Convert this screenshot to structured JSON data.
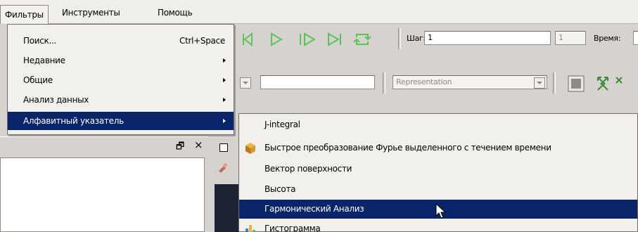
{
  "menubar": {
    "items": [
      "Фильтры",
      "Инструменты",
      "Помощь"
    ]
  },
  "toolbar": {
    "step_label": "Шаг:",
    "step_value": "1",
    "time_index_value": "1",
    "time_label": "Время:",
    "representation_placeholder": "Representation"
  },
  "filters_menu": {
    "items": [
      {
        "label": "Поиск...",
        "shortcut": "Ctrl+Space",
        "has_submenu": false
      },
      {
        "label": "Недавние",
        "shortcut": "",
        "has_submenu": true
      },
      {
        "label": "Общие",
        "shortcut": "",
        "has_submenu": true
      },
      {
        "label": "Анализ данных",
        "shortcut": "",
        "has_submenu": true
      },
      {
        "label": "Алфавитный указатель",
        "shortcut": "",
        "has_submenu": true
      }
    ],
    "selected_index": 4
  },
  "alphabetical_submenu": {
    "items": [
      {
        "label": "J-integral",
        "icon": "none-icon"
      },
      {
        "label": "Быстрое преобразование Фурье выделенного с течением времени",
        "icon": "box-icon"
      },
      {
        "label": "Вектор поверхности",
        "icon": "none-icon"
      },
      {
        "label": "Высота",
        "icon": "none-icon"
      },
      {
        "label": "Гармонический Анализ",
        "icon": "none-icon"
      },
      {
        "label": "Гистограмма",
        "icon": "histogram-icon"
      }
    ],
    "selected_index": 4
  },
  "panel": {
    "float_glyph": "🗗",
    "close_glyph": "×"
  },
  "colors": {
    "selection": "#0a246a",
    "menu_background": "#f1f0ed",
    "toolbar_background": "#d6d3ce",
    "playback_icon": "#5ec15e"
  }
}
